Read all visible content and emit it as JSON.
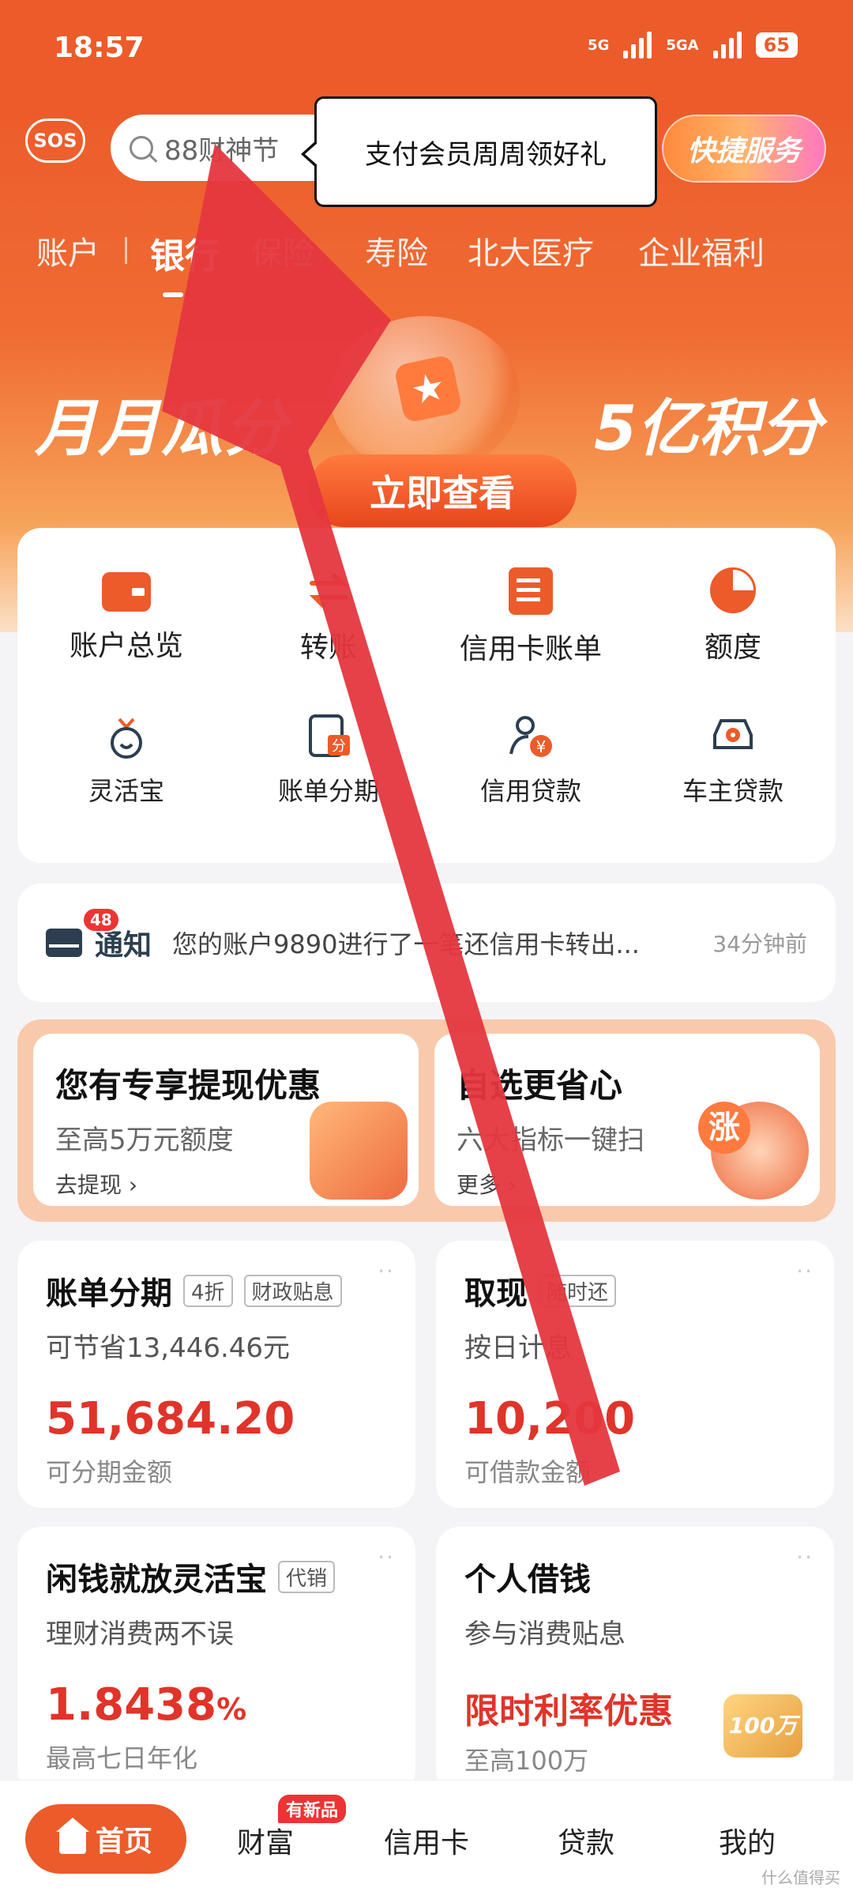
{
  "status": {
    "time": "18:57",
    "network1": "5G",
    "network2": "5GA",
    "battery": "65"
  },
  "header": {
    "sos_label": "SOS",
    "search_placeholder": "88财神节",
    "tooltip": "支付会员周周领好礼",
    "quick_service": "快捷服务"
  },
  "tabs": [
    {
      "label": "账户"
    },
    {
      "label": "银行"
    },
    {
      "label": "保险"
    },
    {
      "label": "寿险"
    },
    {
      "label": "北大医疗"
    },
    {
      "label": "企业福利"
    }
  ],
  "banner": {
    "left_text": "月月瓜分",
    "right_text": "5亿积分",
    "button": "立即查看"
  },
  "menu": [
    {
      "label": "账户总览",
      "icon": "wallet-icon"
    },
    {
      "label": "转账",
      "icon": "transfer-icon"
    },
    {
      "label": "信用卡账单",
      "icon": "bill-icon"
    },
    {
      "label": "额度",
      "icon": "pie-chart-icon"
    },
    {
      "label": "灵活宝",
      "icon": "money-bag-icon"
    },
    {
      "label": "账单分期",
      "icon": "installment-icon"
    },
    {
      "label": "信用贷款",
      "icon": "credit-loan-icon"
    },
    {
      "label": "车主贷款",
      "icon": "car-icon"
    }
  ],
  "notice": {
    "badge": "48",
    "label": "通知",
    "text": "您的账户9890进行了一笔还信用卡转出...",
    "time": "34分钟前"
  },
  "promos": [
    {
      "title": "您有专享提现优惠",
      "subtitle": "至高5万元额度",
      "link": "去提现 ›"
    },
    {
      "title": "自选更省心",
      "subtitle": "六大指标一键扫",
      "link": "更多 ›",
      "deco": "涨"
    }
  ],
  "finance_cards": [
    {
      "title": "账单分期",
      "tags": [
        "4折",
        "财政贴息"
      ],
      "subtitle": "可节省13,446.46元",
      "value": "51,684.20",
      "note": "可分期金额"
    },
    {
      "title": "取现",
      "tags": [
        "随时还"
      ],
      "subtitle": "按日计息",
      "value": "10,200",
      "note": "可借款金额"
    },
    {
      "title": "闲钱就放灵活宝",
      "tags": [
        "代销"
      ],
      "subtitle": "理财消费两不误",
      "value": "1.8438",
      "value_suffix": "%",
      "note": "最高七日年化"
    },
    {
      "title": "个人借钱",
      "tags": [],
      "subtitle": "参与消费贴息",
      "value": "限时利率优惠",
      "note": "至高100万",
      "deco": "100万"
    }
  ],
  "bottom_nav": {
    "home": "首页",
    "wealth": "财富",
    "wealth_badge": "有新品",
    "credit_card": "信用卡",
    "loan": "贷款",
    "mine": "我的"
  },
  "watermark": "什么值得买",
  "colors": {
    "brand": "#ec5b2a",
    "value_red": "#e0342a",
    "arrow": "#e5373f"
  }
}
